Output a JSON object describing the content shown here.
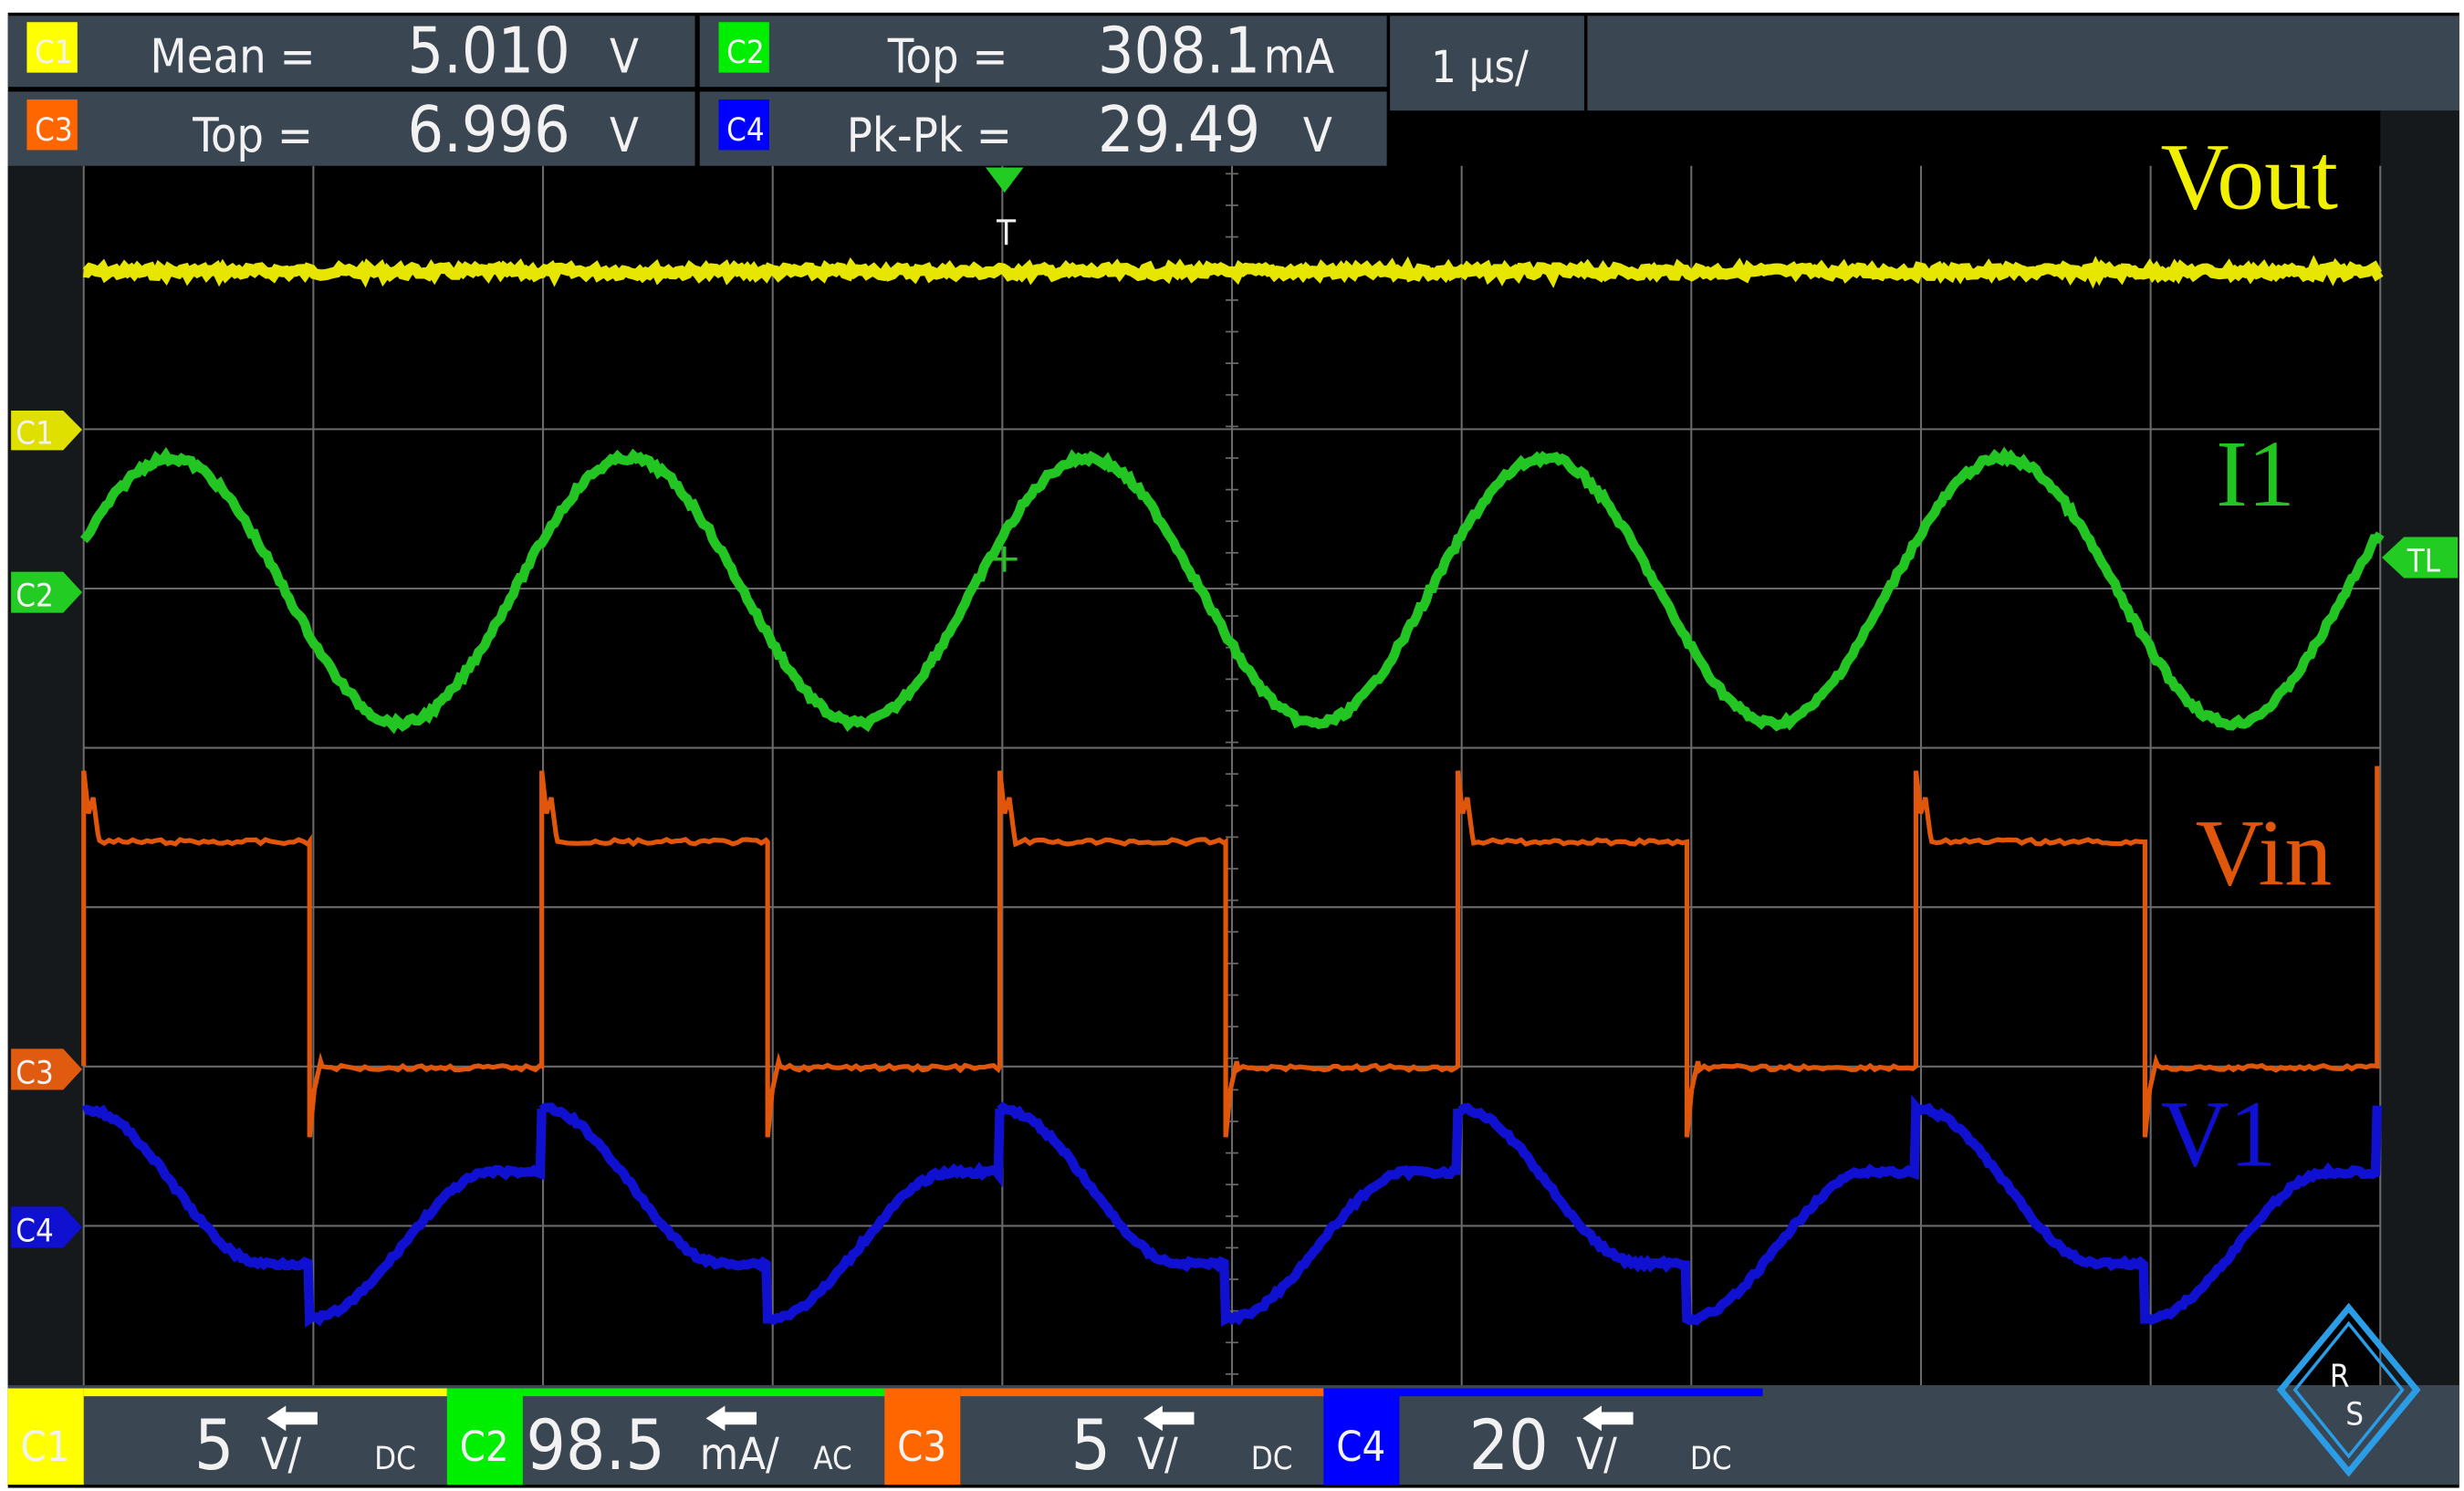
{
  "measurements": [
    {
      "channel": "C1",
      "name": "Mean =",
      "value": "5.010",
      "unit": "V",
      "color": "#ffff00"
    },
    {
      "channel": "C2",
      "name": "Top =",
      "value": "308.1",
      "unit": "mA",
      "color": "#00ee00"
    },
    {
      "channel": "C3",
      "name": "Top =",
      "value": "6.996",
      "unit": "V",
      "color": "#ff6600"
    },
    {
      "channel": "C4",
      "name": "Pk-Pk =",
      "value": "29.49",
      "unit": "V",
      "color": "#0000ff"
    }
  ],
  "timebase": "1 µs/",
  "trigger_marker": "T",
  "trigger_level_marker": "TL",
  "channel_markers": [
    "C1",
    "C2",
    "C3",
    "C4"
  ],
  "trace_labels": {
    "vout": "Vout",
    "i1": "I1",
    "vin": "Vin",
    "v1": "V1"
  },
  "channels": [
    {
      "label": "C1",
      "scale": "5",
      "unit": "V/",
      "coupling": "DC",
      "color": "#ffff00"
    },
    {
      "label": "C2",
      "scale": "98.5",
      "unit": "mA/",
      "coupling": "AC",
      "color": "#00ee00"
    },
    {
      "label": "C3",
      "scale": "5",
      "unit": "V/",
      "coupling": "DC",
      "color": "#ff6600"
    },
    {
      "label": "C4",
      "scale": "20",
      "unit": "V/",
      "coupling": "DC",
      "color": "#0000ff"
    }
  ],
  "logo": "R&S",
  "colors": {
    "panel": "#3a4651",
    "grid": "#6a6a6a",
    "vout": "#e6e600",
    "i1": "#22c522",
    "vin": "#e0560a",
    "v1": "#1010d0"
  }
}
